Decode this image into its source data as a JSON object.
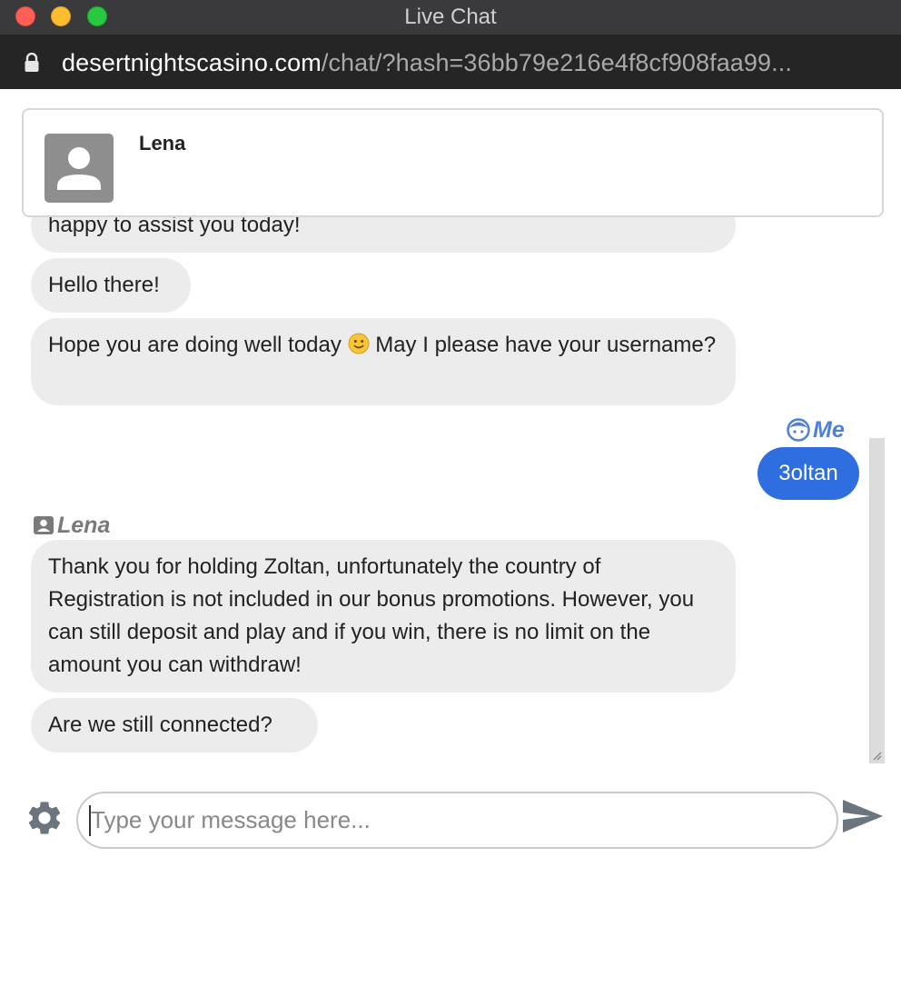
{
  "window": {
    "title": "Live Chat"
  },
  "address_bar": {
    "host": "desertnightscasino.com",
    "path": "/chat/?hash=36bb79e216e4f8cf908faa99..."
  },
  "agent": {
    "name": "Lena"
  },
  "messages": [
    {
      "sender": "agent",
      "text": "happy to assist you today!"
    },
    {
      "sender": "agent",
      "text": "Hello there!"
    },
    {
      "sender": "agent",
      "text_before": "Hope you are doing well today",
      "emoji": "slightly-smiling-face",
      "text_after": "May I please have your username?"
    },
    {
      "sender": "me",
      "label": "Me",
      "text": "3oltan"
    },
    {
      "sender": "agent",
      "label": "Lena",
      "text": "Thank you for holding Zoltan, unfortunately the country of Registration is not included in our bonus promotions. However, you can still deposit and play and if you win, there is no limit on the amount you can withdraw!"
    },
    {
      "sender": "agent",
      "text": "Are we still connected?"
    }
  ],
  "composer": {
    "placeholder": "Type your message here...",
    "value": ""
  },
  "icons": {
    "lock": "lock-icon",
    "agent_avatar": "user-avatar-icon",
    "me": "user-face-icon",
    "agent_label": "contact-card-icon",
    "settings": "gear-icon",
    "send": "send-icon"
  },
  "colors": {
    "accent": "#2f6ee0",
    "me_label": "#4f7fd6",
    "agent_bubble": "#ececec",
    "titlebar": "#3a3a3c",
    "urlbar": "#252526"
  }
}
